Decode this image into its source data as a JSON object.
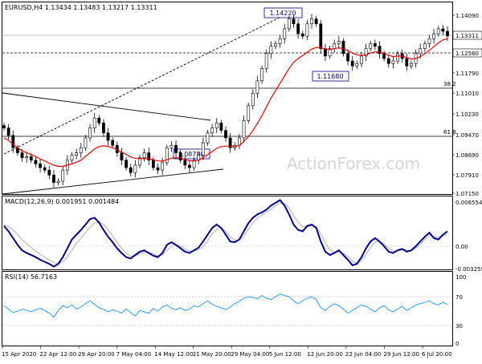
{
  "colors": {
    "frame": "#000000",
    "candle_bull": "#000000",
    "candle_bear": "#000000",
    "ma": "#e00000",
    "macd_line": "#00008b",
    "signal_line": "#bbbbbb",
    "rsi_line": "#1e90ff",
    "trend_line": "#000000",
    "grid_dotted": "#999999",
    "label_box_border": "#000080",
    "label_box_fill": "#ffffff",
    "watermark": "#d5d5d5"
  },
  "header": {
    "symbol_ohlc": "EURUSD,H4  1.13434 1.13483 1.13217 1.13311"
  },
  "watermark": "ActionForex.com",
  "main_panel": {
    "y_ticks": [
      "1.14090",
      "1.13311",
      "1.12580",
      "1.11790",
      "1.11010",
      "1.10230",
      "1.09470",
      "1.08690",
      "1.07910",
      "1.07150"
    ],
    "price_labels": {
      "current": "1.13311",
      "level_1": "1.12580"
    },
    "annotations": {
      "high": "1.14220",
      "low_1": "1.11680",
      "low_2": "1.08700",
      "fib_382": "38.2",
      "fib_618": "61.8"
    }
  },
  "macd_panel": {
    "label": "MACD(12,26,9) 0.001951 0.001484",
    "y_ticks": [
      "0.006554",
      "0.00",
      "-0.003259"
    ]
  },
  "rsi_panel": {
    "label": "RSI(14) 56.7163",
    "y_ticks": [
      "100",
      "70",
      "30",
      "0"
    ]
  },
  "x_axis": {
    "labels": [
      "15 Apr 2020",
      "22 Apr 12:00",
      "29 Apr 20:00",
      "7 May 04:00",
      "14 May 12:00",
      "21 May 20:00",
      "29 May 04:00",
      "5 Jun 12:00",
      "12 Jun 20:00",
      "22 Jun 04:00",
      "29 Jun 12:00",
      "6 Jul 20:00"
    ]
  },
  "chart_data": {
    "type": "candlestick",
    "symbol": "EURUSD",
    "timeframe": "H4",
    "last_ohlc": {
      "open": 1.13434,
      "high": 1.13483,
      "low": 1.13217,
      "close": 1.13311
    },
    "x_range": [
      "2020-04-15",
      "2020-07-09"
    ],
    "ylim": [
      1.07,
      1.146
    ],
    "closes": [
      1.096,
      1.093,
      1.088,
      1.086,
      1.084,
      1.0845,
      1.083,
      1.0815,
      1.08,
      1.079,
      1.077,
      1.074,
      1.0745,
      1.079,
      1.083,
      1.085,
      1.086,
      1.088,
      1.092,
      1.096,
      1.1,
      1.098,
      1.094,
      1.091,
      1.089,
      1.086,
      1.083,
      1.08,
      1.078,
      1.081,
      1.084,
      1.086,
      1.083,
      1.08,
      1.079,
      1.082,
      1.088,
      1.089,
      1.086,
      1.083,
      1.081,
      1.08,
      1.083,
      1.085,
      1.09,
      1.094,
      1.096,
      1.098,
      1.095,
      1.092,
      1.088,
      1.089,
      1.092,
      1.099,
      1.105,
      1.11,
      1.115,
      1.12,
      1.126,
      1.129,
      1.13,
      1.132,
      1.136,
      1.14,
      1.138,
      1.134,
      1.133,
      1.138,
      1.14,
      1.138,
      1.128,
      1.125,
      1.128,
      1.13,
      1.131,
      1.126,
      1.123,
      1.121,
      1.122,
      1.125,
      1.128,
      1.13,
      1.129,
      1.126,
      1.124,
      1.122,
      1.123,
      1.126,
      1.124,
      1.121,
      1.122,
      1.126,
      1.128,
      1.13,
      1.132,
      1.134,
      1.136,
      1.135,
      1.1331
    ],
    "moving_average": [
      1.092,
      1.091,
      1.0895,
      1.088,
      1.0868,
      1.086,
      1.0853,
      1.0845,
      1.0835,
      1.0827,
      1.0818,
      1.081,
      1.0805,
      1.0805,
      1.081,
      1.0815,
      1.0822,
      1.083,
      1.0845,
      1.086,
      1.0875,
      1.0885,
      1.0888,
      1.0886,
      1.088,
      1.0872,
      1.0863,
      1.0853,
      1.0843,
      1.0838,
      1.0836,
      1.0837,
      1.0836,
      1.0832,
      1.0827,
      1.0826,
      1.0832,
      1.0838,
      1.084,
      1.0838,
      1.0833,
      1.0828,
      1.0827,
      1.083,
      1.084,
      1.0853,
      1.0865,
      1.0878,
      1.0885,
      1.0887,
      1.0885,
      1.0885,
      1.089,
      1.0905,
      1.0925,
      1.095,
      1.0978,
      1.101,
      1.1045,
      1.108,
      1.111,
      1.114,
      1.117,
      1.12,
      1.1225,
      1.124,
      1.1252,
      1.1265,
      1.1278,
      1.1285,
      1.1283,
      1.1278,
      1.1277,
      1.128,
      1.1283,
      1.128,
      1.1272,
      1.1262,
      1.1255,
      1.1252,
      1.1255,
      1.1262,
      1.1267,
      1.1266,
      1.1261,
      1.1253,
      1.1248,
      1.125,
      1.125,
      1.1244,
      1.1238,
      1.124,
      1.1248,
      1.126,
      1.1273,
      1.1288,
      1.1303,
      1.1315,
      1.132
    ],
    "macd": [
      0.0028,
      0.002,
      0.001,
      0.0,
      -0.0008,
      -0.0012,
      -0.0015,
      -0.0018,
      -0.0022,
      -0.0025,
      -0.0028,
      -0.0032,
      -0.0028,
      -0.0018,
      -0.0005,
      0.0008,
      0.0015,
      0.0022,
      0.003,
      0.0038,
      0.004,
      0.0033,
      0.0022,
      0.0012,
      0.0004,
      -0.0005,
      -0.0012,
      -0.0018,
      -0.002,
      -0.0015,
      -0.001,
      -0.0008,
      -0.0012,
      -0.0016,
      -0.0018,
      -0.0012,
      0.0,
      0.0004,
      0.0,
      -0.0005,
      -0.001,
      -0.0012,
      -0.0008,
      -0.0004,
      0.0005,
      0.0015,
      0.0025,
      0.003,
      0.0025,
      0.0015,
      0.0005,
      0.0004,
      0.0008,
      0.002,
      0.0032,
      0.004,
      0.0045,
      0.0048,
      0.0052,
      0.0058,
      0.0062,
      0.0066,
      0.0058,
      0.0045,
      0.003,
      0.0022,
      0.002,
      0.0028,
      0.003,
      0.0025,
      0.0005,
      -0.001,
      -0.0015,
      -0.0012,
      -0.0008,
      -0.0015,
      -0.0022,
      -0.003,
      -0.0028,
      -0.0018,
      -0.0005,
      0.0005,
      0.001,
      0.0005,
      -0.0002,
      -0.001,
      -0.0012,
      -0.0008,
      -0.0006,
      -0.001,
      -0.0008,
      -0.0002,
      0.0005,
      0.0012,
      0.0018,
      0.001,
      0.0008,
      0.0015,
      0.002
    ],
    "signal": [
      0.003,
      0.0027,
      0.0022,
      0.0015,
      0.0008,
      0.0002,
      -0.0004,
      -0.0009,
      -0.0014,
      -0.0018,
      -0.0022,
      -0.0026,
      -0.0028,
      -0.0025,
      -0.0018,
      -0.0008,
      0.0002,
      0.001,
      0.0018,
      0.0026,
      0.0032,
      0.0034,
      0.003,
      0.0022,
      0.0013,
      0.0004,
      -0.0005,
      -0.0012,
      -0.0017,
      -0.0016,
      -0.0013,
      -0.0011,
      -0.0011,
      -0.0013,
      -0.0016,
      -0.0015,
      -0.0008,
      -0.0002,
      0.0,
      -0.0002,
      -0.0006,
      -0.0009,
      -0.0009,
      -0.0007,
      -0.0002,
      0.0006,
      0.0016,
      0.0023,
      0.0025,
      0.002,
      0.0012,
      0.0007,
      0.0007,
      0.0013,
      0.0023,
      0.0032,
      0.0039,
      0.0044,
      0.0048,
      0.0053,
      0.0058,
      0.0062,
      0.0061,
      0.0054,
      0.0043,
      0.0033,
      0.0027,
      0.0027,
      0.0028,
      0.0027,
      0.0016,
      0.0003,
      -0.0007,
      -0.0011,
      -0.001,
      -0.0012,
      -0.0017,
      -0.0024,
      -0.0027,
      -0.0023,
      -0.0014,
      -0.0004,
      0.0004,
      0.0005,
      0.0002,
      -0.0005,
      -0.0009,
      -0.0009,
      -0.0007,
      -0.0008,
      -0.0008,
      -0.0005,
      0.0001,
      0.0008,
      0.0014,
      0.0013,
      0.0011,
      0.0013,
      0.0015
    ],
    "rsi": [
      55,
      50,
      45,
      47,
      50,
      48,
      46,
      49,
      51,
      48,
      44,
      38,
      48,
      55,
      52,
      56,
      50,
      53,
      58,
      62,
      57,
      52,
      50,
      46,
      49,
      47,
      44,
      50,
      45,
      40,
      48,
      46,
      44,
      51,
      47,
      53,
      56,
      51,
      49,
      52,
      48,
      50,
      55,
      53,
      58,
      62,
      57,
      54,
      52,
      49,
      53,
      58,
      61,
      66,
      68,
      67,
      65,
      70,
      66,
      64,
      68,
      72,
      70,
      68,
      62,
      58,
      62,
      66,
      68,
      64,
      52,
      48,
      54,
      58,
      55,
      50,
      44,
      48,
      52,
      56,
      54,
      50,
      46,
      52,
      55,
      49,
      46,
      50,
      54,
      48,
      52,
      56,
      58,
      60,
      62,
      58,
      56,
      60,
      57
    ]
  }
}
